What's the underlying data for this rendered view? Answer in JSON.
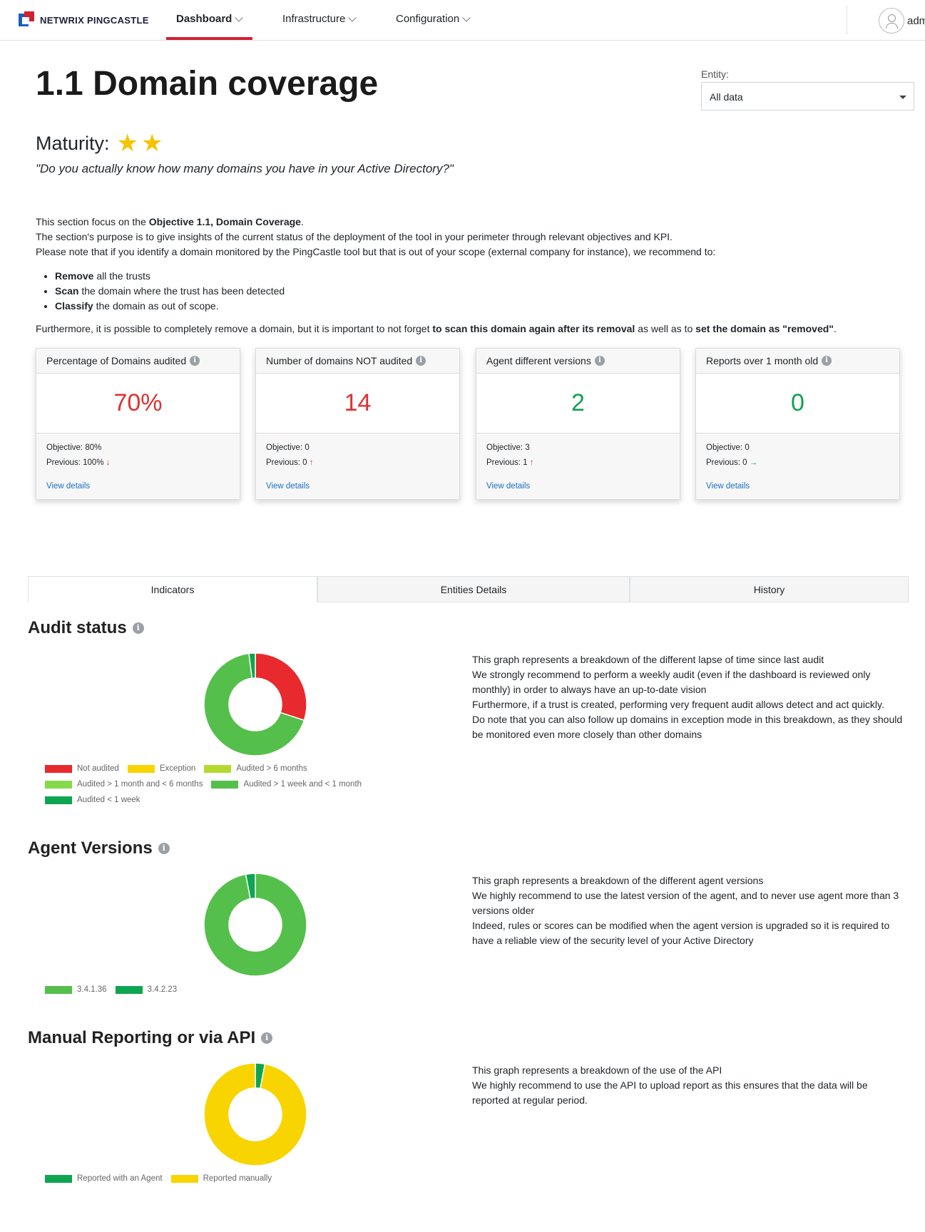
{
  "nav": {
    "brand": "NETWRIX PINGCASTLE",
    "items": [
      {
        "label": "Dashboard"
      },
      {
        "label": "Infrastructure"
      },
      {
        "label": "Configuration"
      }
    ],
    "user": "adm"
  },
  "header": {
    "title": "1.1 Domain coverage",
    "entity_label": "Entity:",
    "entity_value": "All data"
  },
  "maturity": {
    "label": "Maturity:",
    "stars": 2,
    "quote": "\"Do you actually know how many domains you have in your Active Directory?\""
  },
  "intro": {
    "line1_prefix": "This section focus on the ",
    "line1_bold": "Objective 1.1, Domain Coverage",
    "line1_suffix": ".",
    "line2": "The section's purpose is to give insights of the current status of the deployment of the tool in your perimeter through relevant objectives and KPI.",
    "line3": "Please note that if you identify a domain monitored by the PingCastle tool but that is out of your scope (external company for instance), we recommend to:",
    "bullets": [
      {
        "bold": "Remove",
        "text": " all the trusts"
      },
      {
        "bold": "Scan",
        "text": " the domain where the trust has been detected"
      },
      {
        "bold": "Classify",
        "text": " the domain as out of scope."
      }
    ],
    "further_1": "Furthermore, it is possible to completely remove a domain, but it is important to not forget ",
    "further_b1": "to scan this domain again after its removal",
    "further_2": " as well as to ",
    "further_b2": "set the domain as \"removed\"",
    "further_3": "."
  },
  "kpis": [
    {
      "title": "Percentage of Domains audited",
      "value": "70%",
      "objective": "Objective: 80%",
      "previous": "Previous: 100%",
      "trend": "↓",
      "link": "View details"
    },
    {
      "title": "Number of domains NOT audited",
      "value": "14",
      "objective": "Objective: 0",
      "previous": "Previous: 0",
      "trend": "↑",
      "link": "View details"
    },
    {
      "title": "Agent different versions",
      "value": "2",
      "objective": "Objective: 3",
      "previous": "Previous: 1",
      "trend": "↑",
      "link": "View details"
    },
    {
      "title": "Reports over 1 month old",
      "value": "0",
      "objective": "Objective: 0",
      "previous": "Previous: 0",
      "trend": "→",
      "link": "View details"
    }
  ],
  "tabs": [
    {
      "label": "Indicators"
    },
    {
      "label": "Entities Details"
    },
    {
      "label": "History"
    }
  ],
  "audit": {
    "title": "Audit status",
    "desc": [
      "This graph represents a breakdown of the different lapse of time since last audit",
      "We strongly recommend to perform a weekly audit (even if the dashboard is reviewed only monthly) in order to always have an up-to-date vision",
      "Furthermore, if a trust is created, performing very frequent audit allows detect and act quickly.",
      "Do note that you can also follow up domains in exception mode in this breakdown, as they should be monitored even more closely than other domains"
    ],
    "legend": [
      {
        "label": "Not audited",
        "color": "#e8292d"
      },
      {
        "label": "Exception",
        "color": "#f8d400"
      },
      {
        "label": "Audited > 6 months",
        "color": "#b5d930"
      },
      {
        "label": "Audited > 1 month and < 6 months",
        "color": "#86d94a"
      },
      {
        "label": "Audited > 1 week and < 1 month",
        "color": "#55bf4c"
      },
      {
        "label": "Audited < 1 week",
        "color": "#0ea550"
      }
    ]
  },
  "agent": {
    "title": "Agent Versions",
    "desc": [
      "This graph represents a breakdown of the different agent versions",
      "We highly recommend to use the latest version of the agent, and to never use agent more than 3 versions older",
      "Indeed, rules or scores can be modified when the agent version is upgraded so it is required to have a reliable view of the security level of your Active Directory"
    ],
    "legend": [
      {
        "label": "3.4.1.36",
        "color": "#55bf4c"
      },
      {
        "label": "3.4.2.23",
        "color": "#0ea550"
      }
    ]
  },
  "api": {
    "title": "Manual Reporting or via API",
    "desc": [
      "This graph represents a breakdown of the use of the API",
      "We highly recommend to use the API to upload report as this ensures that the data will be reported at regular period."
    ],
    "legend": [
      {
        "label": "Reported with an Agent",
        "color": "#0ea550"
      },
      {
        "label": "Reported manually",
        "color": "#f8d400"
      }
    ]
  },
  "chart_data": [
    {
      "type": "pie",
      "categories": [
        "Not audited",
        "Exception",
        "Audited > 6 months",
        "Audited > 1 month and < 6 months",
        "Audited > 1 week and < 1 month",
        "Audited < 1 week"
      ],
      "values": [
        30,
        0,
        0,
        0,
        68,
        2
      ]
    },
    {
      "type": "pie",
      "categories": [
        "3.4.1.36",
        "3.4.2.23"
      ],
      "values": [
        97,
        3
      ]
    },
    {
      "type": "pie",
      "categories": [
        "Reported with an Agent",
        "Reported manually"
      ],
      "values": [
        3,
        97
      ]
    }
  ]
}
